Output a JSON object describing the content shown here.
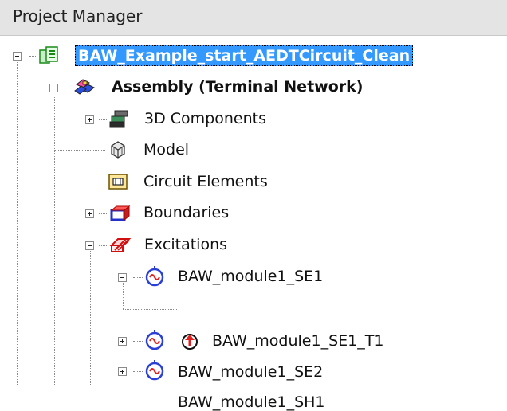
{
  "panel": {
    "title": "Project Manager"
  },
  "tree": {
    "project": "BAW_Example_start_AEDTCircuit_Clean",
    "assembly": "Assembly (Terminal Network)",
    "components": "3D Components",
    "model": "Model",
    "circuit_elements": "Circuit Elements",
    "boundaries": "Boundaries",
    "excitations": "Excitations",
    "se1": "BAW_module1_SE1",
    "se1_t1": "BAW_module1_SE1_T1",
    "se2": "BAW_module1_SE2",
    "sh1": "BAW_module1_SH1"
  }
}
